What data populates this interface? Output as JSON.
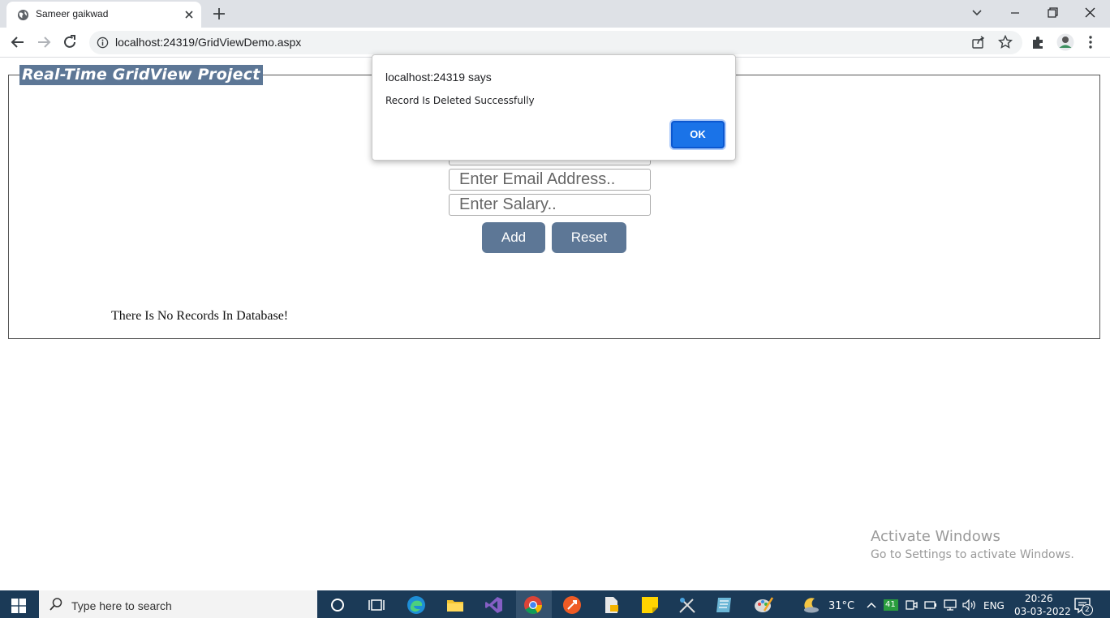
{
  "browser": {
    "tab_title": "Sameer gaikwad",
    "url": "localhost:24319/GridViewDemo.aspx"
  },
  "page": {
    "legend": "Real-Time GridView Project",
    "inputs": {
      "email_placeholder": "Enter Email Address..",
      "salary_placeholder": "Enter Salary.."
    },
    "add_label": "Add",
    "reset_label": "Reset",
    "no_records": "There Is No Records In Database!"
  },
  "dialog": {
    "origin": "localhost:24319 says",
    "message": "Record Is Deleted Successfully",
    "ok_label": "OK"
  },
  "watermark": {
    "line1": "Activate Windows",
    "line2": "Go to Settings to activate Windows."
  },
  "taskbar": {
    "search_placeholder": "Type here to search",
    "weather": "31°C",
    "badge_count": "41",
    "language": "ENG",
    "time": "20:26",
    "date": "03-03-2022",
    "notification_count": "2"
  },
  "colors": {
    "accent": "#5d7796",
    "dialog_button": "#1a73e8",
    "taskbar": "#1b3a57"
  }
}
